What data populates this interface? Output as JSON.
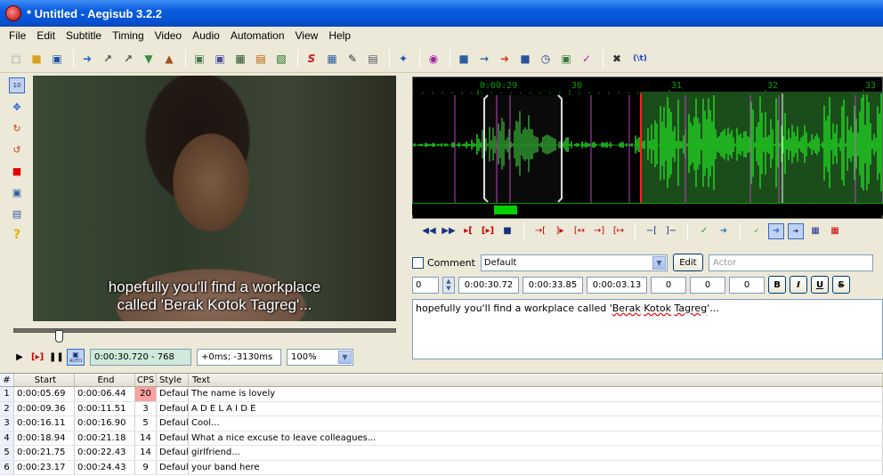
{
  "window": {
    "title": "* Untitled - Aegisub 3.2.2"
  },
  "menu": [
    "File",
    "Edit",
    "Subtitle",
    "Timing",
    "Video",
    "Audio",
    "Automation",
    "View",
    "Help"
  ],
  "toolbar": {
    "extra_label": "(\\t)"
  },
  "video": {
    "subtitle_line1": "hopefully you'll find a workplace",
    "subtitle_line2": "called 'Berak Kotok Tagreg'...",
    "seek_fraction": 0.11,
    "time_display": "0:00:30.720 - 768",
    "offset_display": "+0ms; -3130ms",
    "zoom": "100%",
    "auto_label": "AUTO"
  },
  "audio": {
    "ruler_labels": [
      "0:00:29",
      "30",
      "31",
      "32",
      "33"
    ]
  },
  "edit": {
    "comment_label": "Comment",
    "style": "Default",
    "edit_button": "Edit",
    "actor_placeholder": "Actor",
    "layer": "0",
    "start": "0:00:30.72",
    "end": "0:00:33.85",
    "duration": "0:00:03.13",
    "margin_l": "0",
    "margin_r": "0",
    "margin_v": "0",
    "bold": "B",
    "italic": "I",
    "underline": "U",
    "strike": "S",
    "text_pre": "hopefully you'll find a workplace called '",
    "text_w1": "Berak",
    "text_w2": "Kotok",
    "text_w3": "Tagreg",
    "text_post": "'..."
  },
  "grid": {
    "headers": [
      "#",
      "Start",
      "End",
      "CPS",
      "Style",
      "Text"
    ],
    "rows": [
      {
        "n": "1",
        "start": "0:00:05.69",
        "end": "0:00:06.44",
        "cps": "20",
        "style": "Default",
        "text": "The name is lovely"
      },
      {
        "n": "2",
        "start": "0:00:09.36",
        "end": "0:00:11.51",
        "cps": "3",
        "style": "Default",
        "text": "A D E L A I D E"
      },
      {
        "n": "3",
        "start": "0:00:16.11",
        "end": "0:00:16.90",
        "cps": "5",
        "style": "Default",
        "text": "Cool..."
      },
      {
        "n": "4",
        "start": "0:00:18.94",
        "end": "0:00:21.18",
        "cps": "14",
        "style": "Default",
        "text": "What a nice excuse to leave colleagues..."
      },
      {
        "n": "5",
        "start": "0:00:21.75",
        "end": "0:00:22.43",
        "cps": "14",
        "style": "Default",
        "text": "girlfriend..."
      },
      {
        "n": "6",
        "start": "0:00:23.17",
        "end": "0:00:24.43",
        "cps": "9",
        "style": "Default",
        "text": "your band here"
      }
    ]
  },
  "colors": {
    "cps_warning": "#f9a0a0",
    "waveform": "#00c000",
    "selection": "#1a4a1a"
  }
}
